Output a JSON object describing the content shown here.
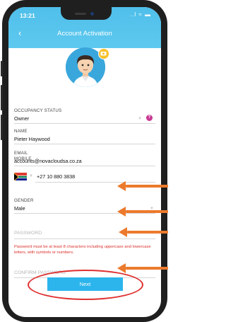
{
  "status_bar": {
    "time": "13:21",
    "icons": "..l ≈ ▬"
  },
  "header": {
    "title": "Account Activation",
    "back_icon": "chevron-left-icon"
  },
  "form": {
    "occupancy_status": {
      "label": "OCCUPANCY STATUS",
      "value": "Owner",
      "help": "?"
    },
    "name": {
      "label": "NAME",
      "value": "Pieter Haywood"
    },
    "email": {
      "label": "EMAIL",
      "value": "accounts@novacloudsa.co.za"
    },
    "mobile": {
      "label": "MOBILE",
      "value": "+27 10 880 3838"
    },
    "gender": {
      "label": "GENDER",
      "value": "Male"
    },
    "password": {
      "placeholder": "PASSWORD"
    },
    "password_error": "Password must be at least 8 characters including uppercase and lowercase letters, with symbols or numbers.",
    "confirm_password": {
      "placeholder": "CONFIRM PASSWORD"
    }
  },
  "next_label": "Next",
  "colors": {
    "header": "#4fbfea",
    "button": "#2cb5ec",
    "error": "#d9302c",
    "annotation_arrow": "#ec7a2c",
    "annotation_ellipse": "#e03030"
  }
}
